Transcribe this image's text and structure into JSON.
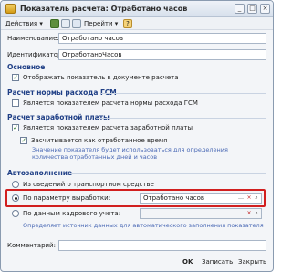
{
  "window": {
    "title": "Показатель расчета: Отработано часов"
  },
  "toolbar": {
    "actions_label": "Действия",
    "goto_label": "Перейти",
    "help_label": "?"
  },
  "form": {
    "name_label": "Наименование:",
    "name_value": "Отработано часов",
    "id_label": "Идентификатор:",
    "id_value": "ОтработаноЧасов"
  },
  "sections": {
    "main_title": "Основное",
    "show_in_doc_label": "Отображать показатель в документе расчета",
    "gsm_title": "Расчет нормы расхода ГСМ",
    "gsm_cb_label": "Является показателем расчета нормы расхода ГСМ",
    "salary_title": "Расчет заработной платы",
    "salary_cb_label": "Является показателем расчета заработной платы",
    "worktime_cb_label": "Засчитывается как отработанное время",
    "worktime_info": "Значение показателя будет использоваться для определения количества отработанных дней и часов",
    "auto_title": "Автозаполнение",
    "radio_transport_label": "Из сведений о транспортном средстве",
    "radio_param_label": "По параметру выработки:",
    "param_value": "Отработано часов",
    "radio_hr_label": "По данным кадрового учета:",
    "auto_info": "Определяет источник данных для автоматического заполнения показателя"
  },
  "comment": {
    "label": "Комментарий:"
  },
  "footer": {
    "ok_label": "OK",
    "save_label": "Записать",
    "close_label": "Закрыть"
  }
}
